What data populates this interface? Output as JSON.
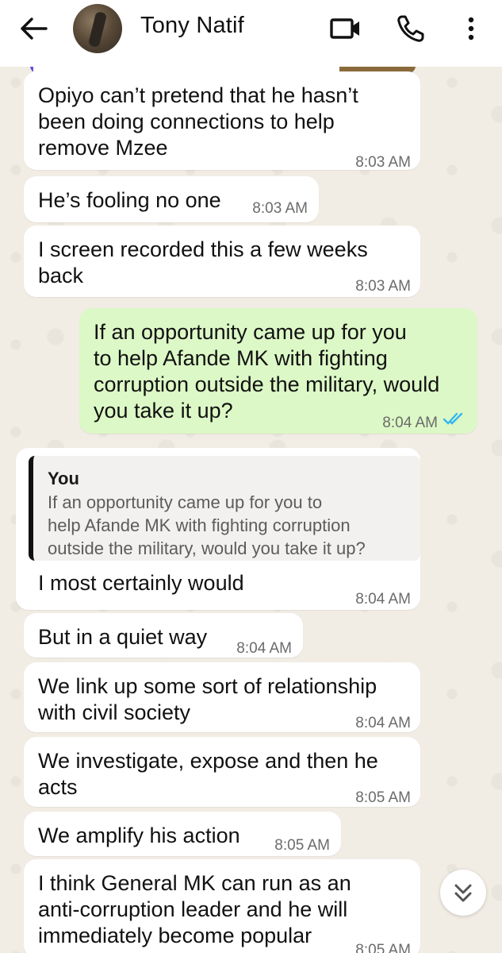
{
  "header": {
    "contact_name": "Tony Natif",
    "icons": [
      "back-arrow-icon",
      "video-call-icon",
      "phone-call-icon",
      "more-options-icon"
    ]
  },
  "messages": [
    {
      "direction": "in",
      "text_lines": [
        "Opiyo can’t pretend that he hasn’t",
        "been doing connections to help",
        "remove Mzee"
      ],
      "time": "8:03 AM"
    },
    {
      "direction": "in",
      "text_lines": [
        "He’s fooling no one"
      ],
      "time": "8:03 AM"
    },
    {
      "direction": "in",
      "text_lines": [
        "I screen recorded this a few weeks",
        "back"
      ],
      "time": "8:03 AM"
    },
    {
      "direction": "out",
      "text_lines": [
        "If an opportunity came up for you",
        "to help Afande MK with fighting",
        "corruption outside the military, would",
        "you take it up?"
      ],
      "time": "8:04 AM",
      "status": "read"
    },
    {
      "direction": "in",
      "quote": {
        "author": "You",
        "text_lines": [
          "If an opportunity came up for you to",
          "help Afande MK with fighting corruption",
          "outside the military, would you take it up?"
        ]
      },
      "text_lines": [
        "I most certainly would"
      ],
      "time": "8:04 AM"
    },
    {
      "direction": "in",
      "text_lines": [
        "But in a quiet way"
      ],
      "time": "8:04 AM"
    },
    {
      "direction": "in",
      "text_lines": [
        "We link up some sort of relationship",
        "with civil society"
      ],
      "time": "8:04 AM"
    },
    {
      "direction": "in",
      "text_lines": [
        "We investigate, expose and then he",
        "acts"
      ],
      "time": "8:05 AM"
    },
    {
      "direction": "in",
      "text_lines": [
        "We amplify his action"
      ],
      "time": "8:05 AM"
    },
    {
      "direction": "in",
      "text_lines": [
        "I think General MK can run as an",
        "anti-corruption leader and he will",
        "immediately become popular"
      ],
      "time": "8:05 AM"
    }
  ],
  "colors": {
    "chat_background": "#f1ece4",
    "incoming_bubble": "#ffffff",
    "outgoing_bubble": "#dcf8c6",
    "read_ticks": "#34b7f1"
  }
}
